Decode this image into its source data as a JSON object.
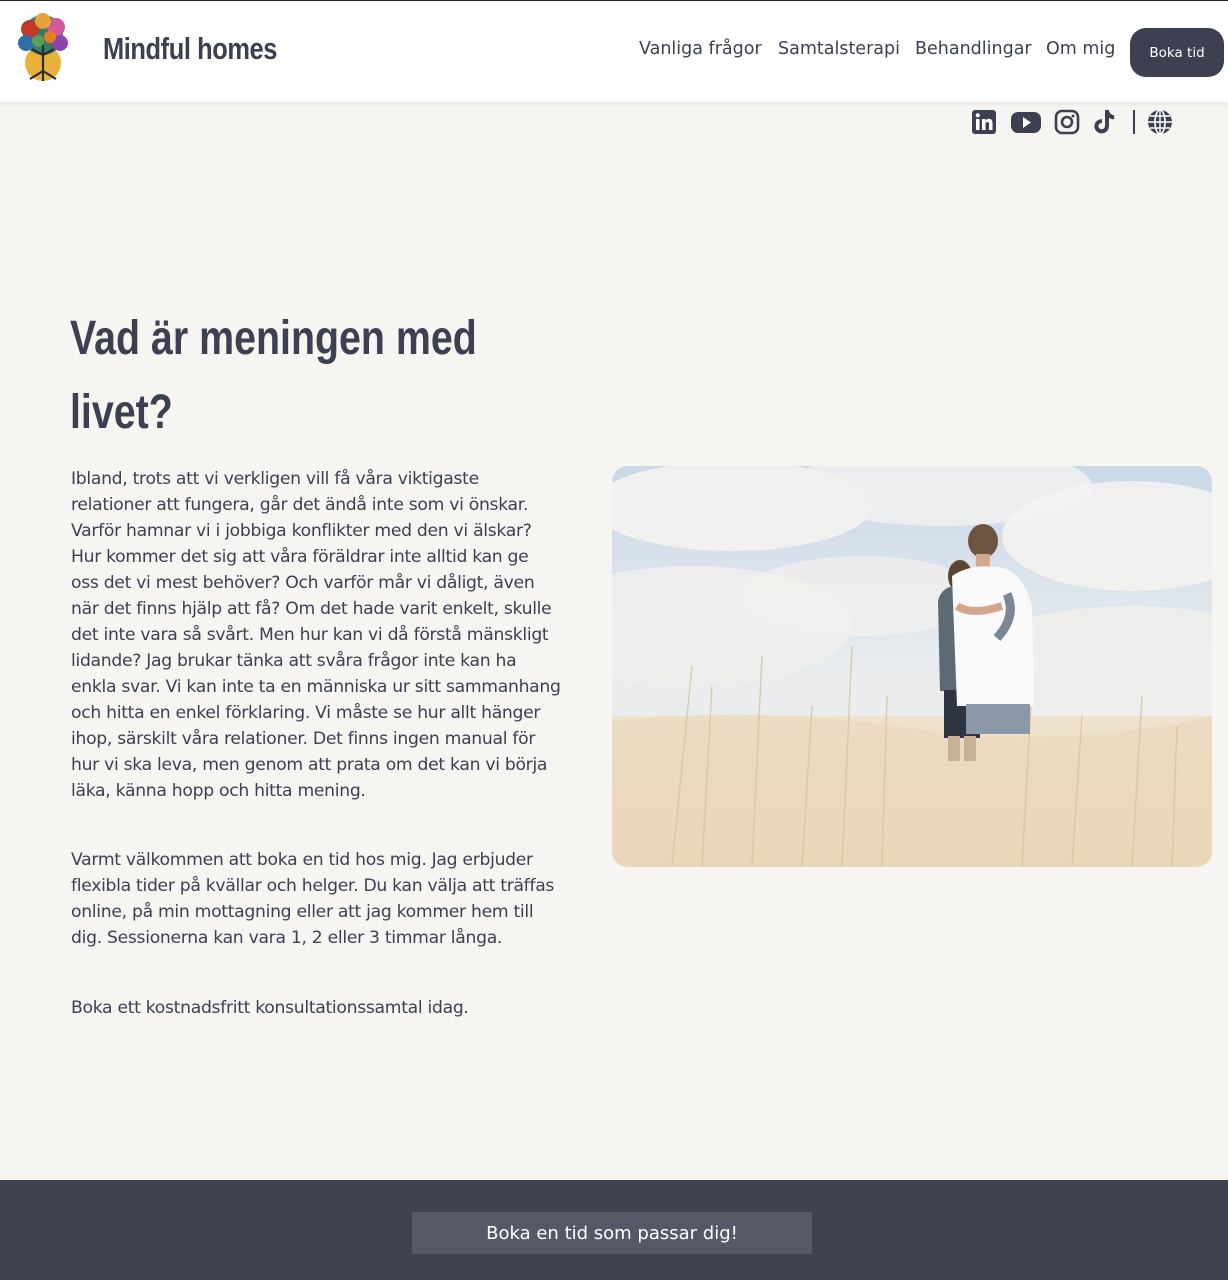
{
  "header": {
    "brand": "Mindful homes",
    "nav": {
      "faq": "Vanliga frågor",
      "therapy": "Samtalsterapi",
      "treatments": "Behandlingar",
      "about": "Om mig"
    },
    "book_button": "Boka tid"
  },
  "social": [
    "linkedin-icon",
    "youtube-icon",
    "instagram-icon",
    "tiktok-icon",
    "globe-icon"
  ],
  "main": {
    "heading": "Vad är meningen med livet?",
    "paragraphs": [
      "Ibland, trots att vi verkligen vill få våra viktigaste relationer att fungera, går det ändå inte som vi önskar. Varför hamnar vi i jobbiga konflikter med den vi älskar? Hur kommer det sig att våra föräldrar inte alltid kan ge oss det vi mest behöver? Och varför mår vi dåligt, även när det finns hjälp att få? Om det hade varit enkelt, skulle det inte vara så svårt. Men hur kan vi då förstå mänskligt lidande? Jag brukar tänka att svåra frågor inte kan ha enkla svar. Vi kan inte ta en människa ur sitt sammanhang och hitta en enkel förklaring. Vi måste se hur allt hänger ihop, särskilt våra relationer. Det finns ingen manual för hur vi ska leva, men genom att prata om det kan vi börja läka, känna hopp och hitta mening.",
      "Varmt välkommen att boka en tid hos mig. Jag erbjuder flexibla tider på kvällar och helger. Du kan välja att träffas online, på min mottagning eller att jag kommer hem till dig. Sessionerna kan vara 1, 2 eller 3 timmar långa.",
      "Boka ett kostnadsfritt konsultationssamtal idag."
    ]
  },
  "footer": {
    "cta": "Boka en tid som passar dig!"
  },
  "colors": {
    "primary": "#3d4051",
    "background": "#f6f5f2",
    "footer": "#41424f",
    "footer_button": "#565868"
  }
}
